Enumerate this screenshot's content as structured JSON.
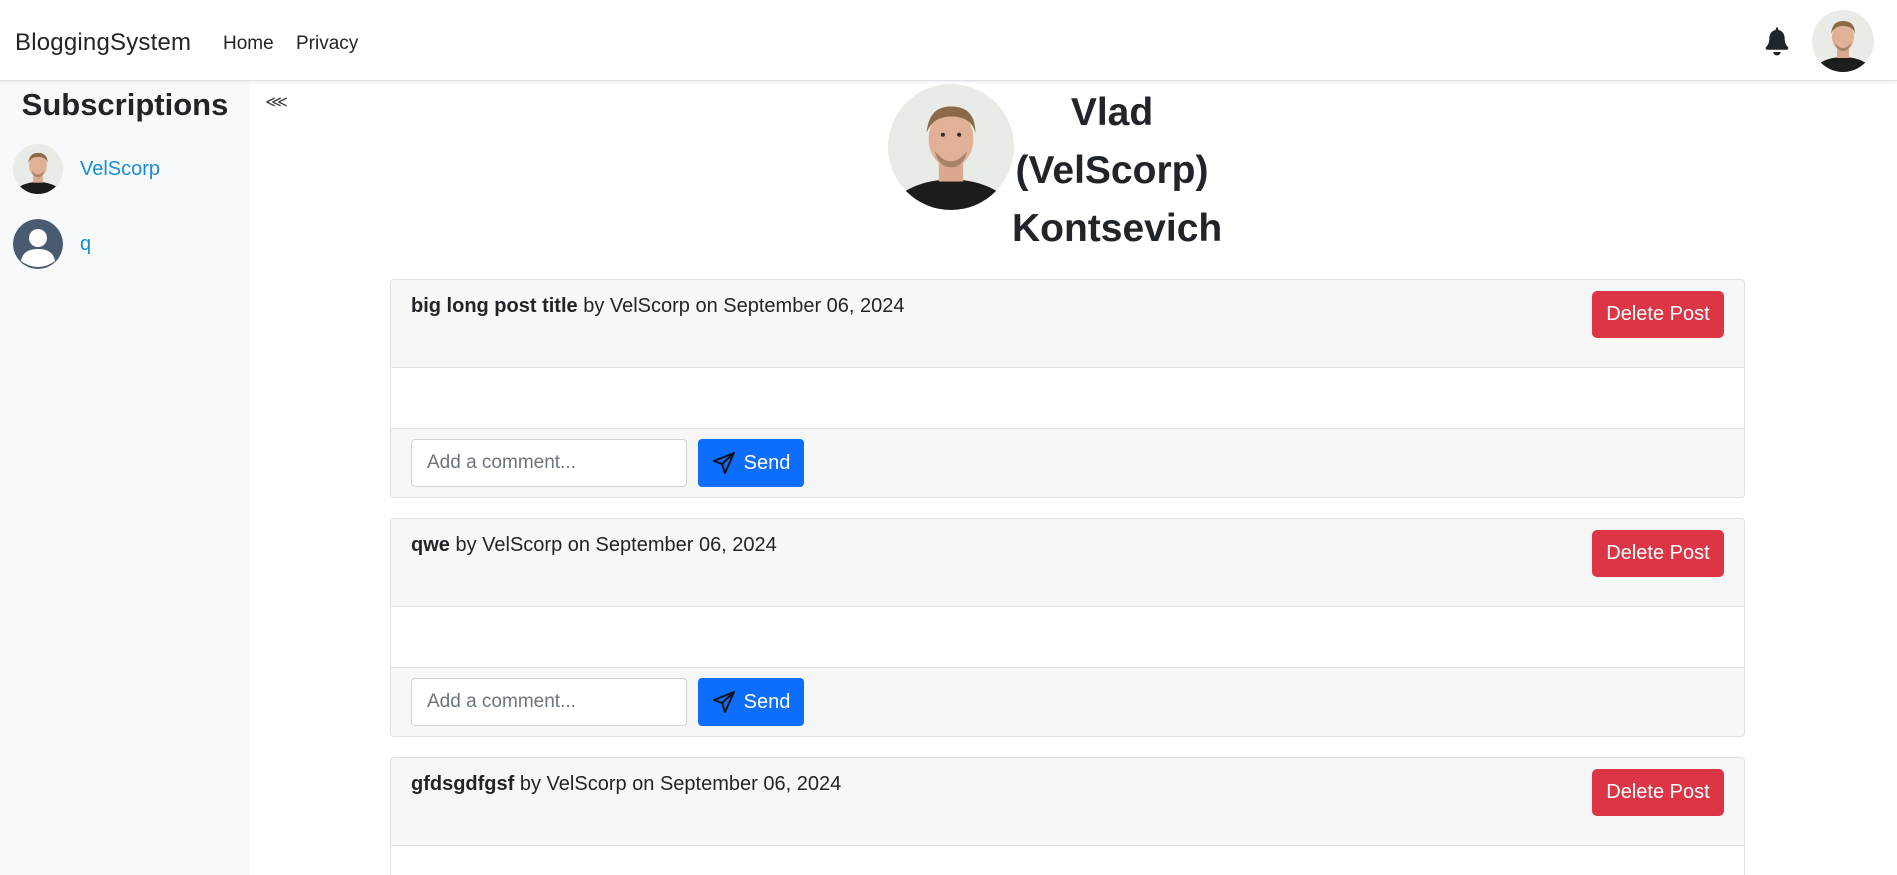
{
  "navbar": {
    "brand": "BloggingSystem",
    "links": [
      {
        "label": "Home"
      },
      {
        "label": "Privacy"
      }
    ],
    "notification_icon": "bell-icon",
    "avatar_icon": "user-avatar"
  },
  "sidebar": {
    "title": "Subscriptions",
    "collapse_icon": "⋘",
    "items": [
      {
        "label": "VelScorp",
        "avatar": "photo-avatar"
      },
      {
        "label": "q",
        "avatar": "default-user-avatar"
      }
    ]
  },
  "profile": {
    "first_name": "Vlad",
    "username": "(VelScorp)",
    "last_name": "Kontsevich"
  },
  "posts": [
    {
      "title": "big long post title",
      "meta": " by VelScorp on September 06, 2024",
      "body": "",
      "delete_label": "Delete Post",
      "comment_placeholder": "Add a comment...",
      "send_label": "Send"
    },
    {
      "title": "qwe",
      "meta": " by VelScorp on September 06, 2024",
      "body": "",
      "delete_label": "Delete Post",
      "comment_placeholder": "Add a comment...",
      "send_label": "Send"
    },
    {
      "title": "gfdsgdfgsf",
      "meta": " by VelScorp on September 06, 2024",
      "delete_label": "Delete Post"
    }
  ],
  "colors": {
    "danger": "#dc3545",
    "primary": "#0d6efd",
    "link": "#1a8cd8",
    "sidebar_bg": "#f8f9fa"
  }
}
